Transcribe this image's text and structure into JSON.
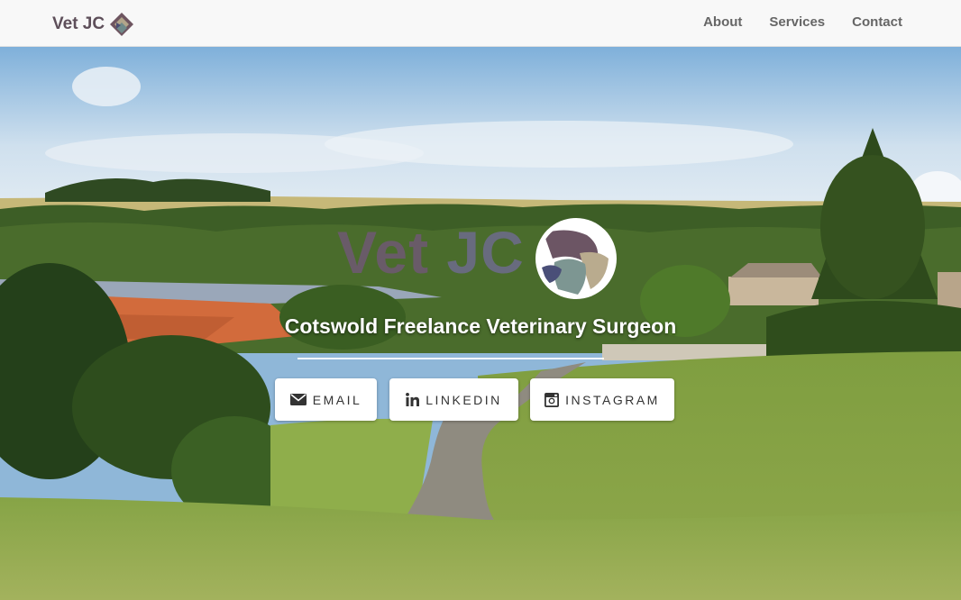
{
  "navbar": {
    "brand": "Vet JC",
    "links": [
      "About",
      "Services",
      "Contact"
    ]
  },
  "hero": {
    "title_vet": "Vet",
    "title_jc": "JC",
    "subtitle": "Cotswold Freelance Veterinary Surgeon",
    "buttons": {
      "email": "EMAIL",
      "linkedin": "LINKEDIN",
      "instagram": "INSTAGRAM"
    }
  },
  "icons": {
    "brand_logo": "vet-logo-icon",
    "email": "envelope-icon",
    "linkedin": "linkedin-icon",
    "instagram": "instagram-icon"
  },
  "colors": {
    "brand": "#5e4f5a",
    "title_vet": "#6c5a6e",
    "title_jc": "#6b6b86",
    "navbar_bg": "#f8f8f8"
  }
}
